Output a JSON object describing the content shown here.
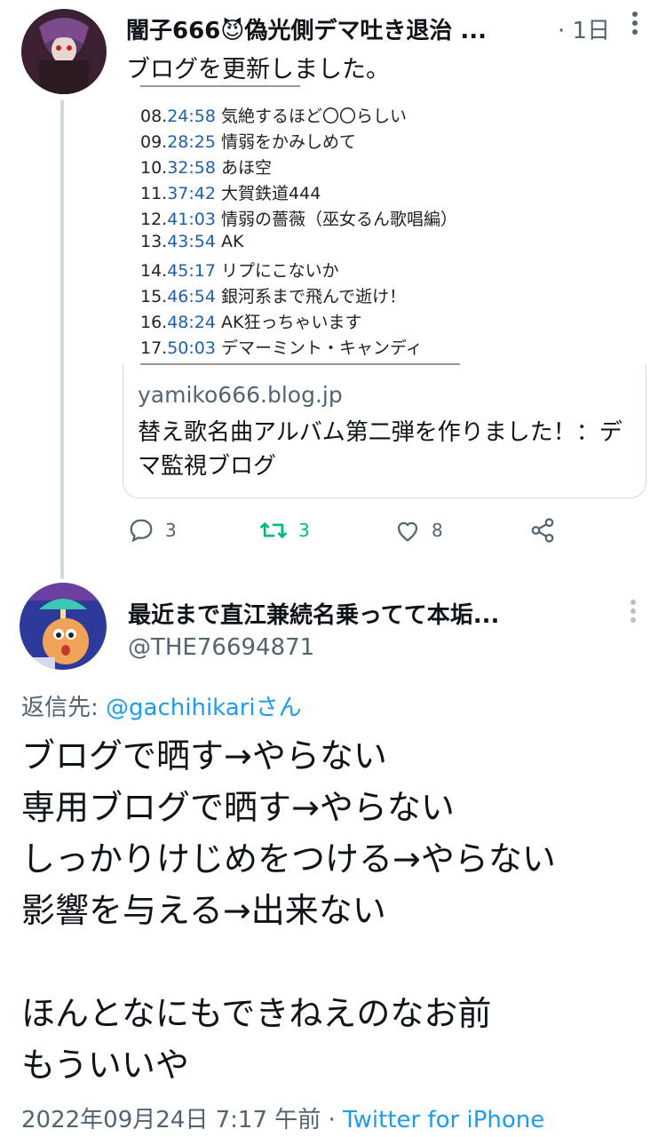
{
  "tweet1": {
    "author_name": "闇子666😈偽光側デマ吐き退治 ...",
    "time": "· 1日",
    "text": "ブログを更新しました。",
    "tracks": [
      {
        "num": "08.",
        "time": "24:58",
        "title": "気絶するほど〇〇らしい"
      },
      {
        "num": "09.",
        "time": "28:25",
        "title": "情弱をかみしめて"
      },
      {
        "num": "10.",
        "time": "32:58",
        "title": "あほ空"
      },
      {
        "num": "11.",
        "time": "37:42",
        "title": "大賀鉄道444"
      },
      {
        "num": "12.",
        "time": "41:03",
        "title": "情弱の薔薇（巫女るん歌唱編）"
      },
      {
        "num": "13.",
        "time": "43:54",
        "title": "AK"
      },
      {
        "num": "14.",
        "time": "45:17",
        "title": "リプにこないか"
      },
      {
        "num": "15.",
        "time": "46:54",
        "title": "銀河系まで飛んで逝け！"
      },
      {
        "num": "16.",
        "time": "48:24",
        "title": "AK狂っちゃいます"
      },
      {
        "num": "17.",
        "time": "50:03",
        "title": "デマーミント・キャンディ"
      }
    ],
    "card": {
      "domain": "yamiko666.blog.jp",
      "title": "替え歌名曲アルバム第二弾を作りました！：デマ監視ブログ"
    },
    "actions": {
      "replies": "3",
      "retweets": "3",
      "likes": "8"
    }
  },
  "tweet2": {
    "author_name": "最近まで直江兼続名乗ってて本垢...",
    "handle": "@THE76694871",
    "reply_to_prefix": "返信先: ",
    "reply_to_user": "@gachihikariさん",
    "text": "ブログで晒す→やらない\n専用ブログで晒す→やらない\nしっかりけじめをつける→やらない\n影響を与える→出来ない\n\nほんとなにもできねえのなお前\nもういいや",
    "timestamp": "2022年09月24日 7:17 午前",
    "separator": " · ",
    "source": "Twitter for iPhone"
  },
  "colors": {
    "accent": "#1d9bf0",
    "retweet": "#00ba7c",
    "muted": "#536471"
  }
}
